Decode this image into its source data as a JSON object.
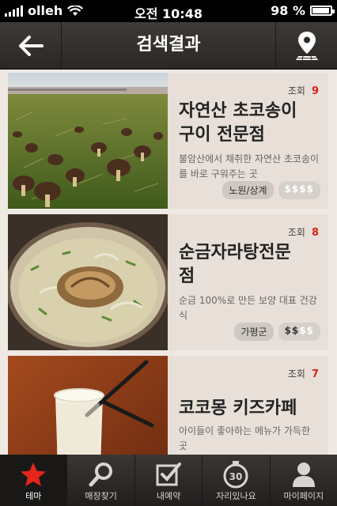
{
  "status": {
    "carrier": "olleh",
    "time": "오전 10:48",
    "battery": "98 %",
    "battery_level": 0.98
  },
  "header": {
    "title": "검색결과"
  },
  "results": [
    {
      "views_label": "조회",
      "views": "9",
      "name": "자연산 초코송이\n구이 전문점",
      "desc": "불암산에서 채취한 자연산 초코송이를 바로 구워주는 곳",
      "region": "노원/상계",
      "price_level": 0,
      "price_max": 4
    },
    {
      "views_label": "조회",
      "views": "8",
      "name": "순금자라탕전문\n점",
      "desc": "순금 100%로 만든 보양 대표 건강식",
      "region": "가평군",
      "price_level": 2,
      "price_max": 4
    },
    {
      "views_label": "조회",
      "views": "7",
      "name": "코코몽 키즈카페",
      "desc": "아이들이 좋아하는 메뉴가 가득한 곳",
      "region": "",
      "price_level": 0,
      "price_max": 4
    }
  ],
  "tabs": [
    {
      "label": "테마",
      "icon": "star-icon"
    },
    {
      "label": "매장찾기",
      "icon": "search-icon"
    },
    {
      "label": "내예약",
      "icon": "checkbox-icon"
    },
    {
      "label": "자리있나요",
      "icon": "timer-30-icon"
    },
    {
      "label": "마이페이지",
      "icon": "person-icon"
    }
  ],
  "colors": {
    "accent": "#d9241b",
    "header": "#2f2c2a",
    "card_info": "#e7dfd8"
  }
}
